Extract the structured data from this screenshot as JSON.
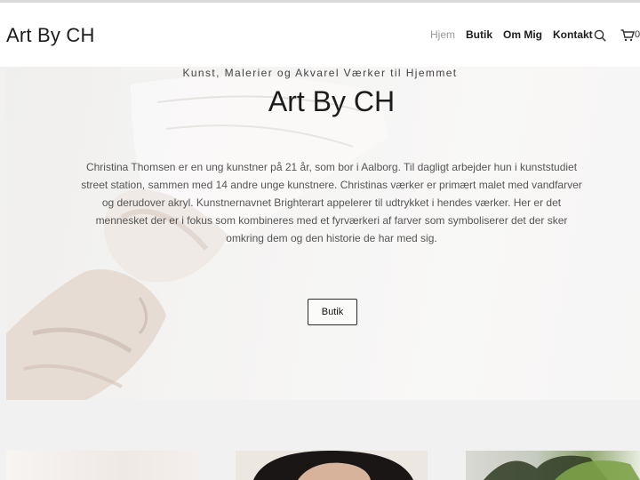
{
  "site": {
    "logo": "Art By CH"
  },
  "nav": {
    "items": [
      {
        "label": "Hjem",
        "active": true
      },
      {
        "label": "Butik",
        "active": false
      },
      {
        "label": "Om Mig",
        "active": false
      },
      {
        "label": "Kontakt",
        "active": false
      }
    ],
    "search_icon": "search-icon",
    "cart_icon": "cart-icon",
    "cart_count": "0"
  },
  "hero": {
    "tagline": "Kunst, Malerier og Akvarel Værker til Hjemmet",
    "title": "Art By CH",
    "text": "Christina Thomsen er en ung kunstner på 21 år, som bor i Aalborg. Til dagligt arbejder hun i kunststudiet street station, sammen med 14 andre unge kunstnere. Christinas værker er primært malet med vandfarver og derudover akryl. Kunstnernavnet Brighterart appelerer til udtrykket i hendes værker. Her er det mennesket der er i fokus som kombineres med et fyrværkeri af farver som symboliserer det der sker omkring dem og den historie de har med sig.",
    "button_label": "Butik"
  },
  "colors": {
    "text_dark": "#1c1c1c",
    "nav_active": "#9a9a9a",
    "page_bg": "#f1f1f1"
  }
}
